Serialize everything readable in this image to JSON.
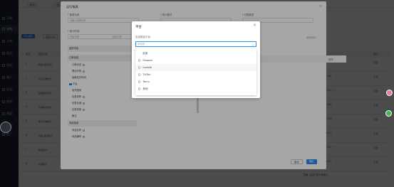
{
  "sidebar": {
    "items": [
      {
        "label": "订单"
      },
      {
        "label": "采购"
      },
      {
        "label": "入库"
      },
      {
        "label": "商品"
      },
      {
        "label": "仓库"
      },
      {
        "label": "客户"
      },
      {
        "label": "报表"
      },
      {
        "label": "财务"
      },
      {
        "label": "数据"
      },
      {
        "label": "设置"
      },
      {
        "label": "推广"
      }
    ]
  },
  "topbar": {
    "tabs": [
      "首页",
      "运营报表"
    ]
  },
  "toolbar": {
    "query_label": "导出报表",
    "set_label": "自定义列"
  },
  "table": {
    "headers": [
      "序号",
      "报表名称",
      "报表类型",
      "创建时间",
      "操作"
    ],
    "rows": [
      {
        "no": "1",
        "name": "商品-销售统计",
        "type": "自定义",
        "time": "2023-08-22 10:44:01",
        "action": "查看"
      },
      {
        "no": "2",
        "name": "平台订单统计",
        "type": "自定义",
        "time": "2023-08-22 10:32:45",
        "action": "查看"
      },
      {
        "no": "3",
        "name": "店铺销售统计",
        "type": "自定义",
        "time": "2023-08-21 18:05:12",
        "action": "查看"
      },
      {
        "no": "4",
        "name": "仓库库存统计",
        "type": "自定义",
        "time": "2023-08-21 17:40:28",
        "action": "查看"
      },
      {
        "no": "5",
        "name": "客户订单统计",
        "type": "自定义",
        "time": "2023-08-21 15:22:09",
        "action": "查看"
      },
      {
        "no": "6",
        "name": "商品-退货统计",
        "type": "自定义",
        "time": "2023-08-20 11:08:33",
        "action": "查看"
      },
      {
        "no": "7",
        "name": "物流统计",
        "type": "自定义",
        "time": "2023-08-19 16:51:47",
        "action": "查看"
      },
      {
        "no": "8",
        "name": "利润统计",
        "type": "自定义",
        "time": "2023-08-18 09:30:15",
        "action": "查看"
      }
    ],
    "footer": "查看 · 运营平台订单统计"
  },
  "panel": {
    "title": "运行报表",
    "fields": {
      "name_label": "* 报表名称",
      "name_placeholder": "请输入报表名称",
      "mode_label": "* 统计模式",
      "type_label": "* 日期类型",
      "time_label": "* 统计时间",
      "time_start": "开始日期",
      "time_end": "结束日期",
      "filter_label": "添加条件"
    },
    "columns": [
      {
        "label": "选择字段",
        "group": true
      },
      {
        "label": "订单信息",
        "group": true
      },
      {
        "label": "订单状态",
        "checked": false,
        "info": true
      },
      {
        "label": "理论时效",
        "checked": false,
        "info": true
      },
      {
        "label": "最晚发货时间",
        "checked": false
      },
      {
        "label": "平台",
        "checked": true
      },
      {
        "label": "收货国家",
        "checked": false
      },
      {
        "label": "包裹体积",
        "checked": false,
        "info": true
      },
      {
        "label": "包裹长度",
        "checked": false,
        "info": true
      },
      {
        "label": "包裹宽度",
        "checked": false,
        "info": true
      },
      {
        "label": "备注",
        "checked": false
      },
      {
        "label": "商品信息",
        "group": true
      },
      {
        "label": "商品名称",
        "checked": false,
        "info": true
      },
      {
        "label": "商品编号",
        "checked": false,
        "info": true
      }
    ],
    "preview_col": "操作",
    "cancel_label": "取消",
    "confirm_label": "确定"
  },
  "modal": {
    "title": "平台",
    "close_icon": "close-icon",
    "field_label": "包含指定平台",
    "select_placeholder": "请选择",
    "options": [
      "全部",
      "Shopee",
      "Lazada",
      "TikTok",
      "Temu",
      "其他"
    ]
  },
  "colors": {
    "accent": "#2d8cf0",
    "sidebar_bg": "#1d2433"
  }
}
